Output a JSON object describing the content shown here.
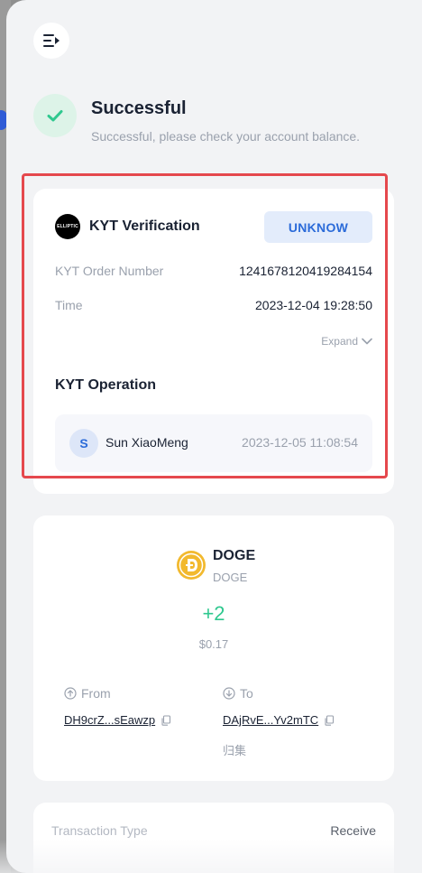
{
  "status": {
    "title": "Successful",
    "description": "Successful, please check your account balance."
  },
  "kyt": {
    "logo_text": "ELLIPTIC",
    "title": "KYT Verification",
    "badge": "UNKNOW",
    "order_label": "KYT Order Number",
    "order_value": "1241678120419284154",
    "time_label": "Time",
    "time_value": "2023-12-04 19:28:50",
    "expand_label": "Expand",
    "operation_title": "KYT Operation",
    "operator_initial": "S",
    "operator_name": "Sun XiaoMeng",
    "operation_time": "2023-12-05 11:08:54"
  },
  "asset": {
    "coin_name": "DOGE",
    "coin_symbol": "DOGE",
    "amount": "+2",
    "fiat_value": "$0.17",
    "from_label": "From",
    "from_address": "DH9crZ...sEawzp",
    "to_label": "To",
    "to_address": "DAjRvE...Yv2mTC",
    "to_tag": "归集"
  },
  "transaction": {
    "type_label": "Transaction Type",
    "type_value": "Receive"
  },
  "colors": {
    "success": "#2fc88f",
    "accent": "#2b6bd9",
    "highlight": "#e5484d",
    "doge": "#f2b92e"
  }
}
